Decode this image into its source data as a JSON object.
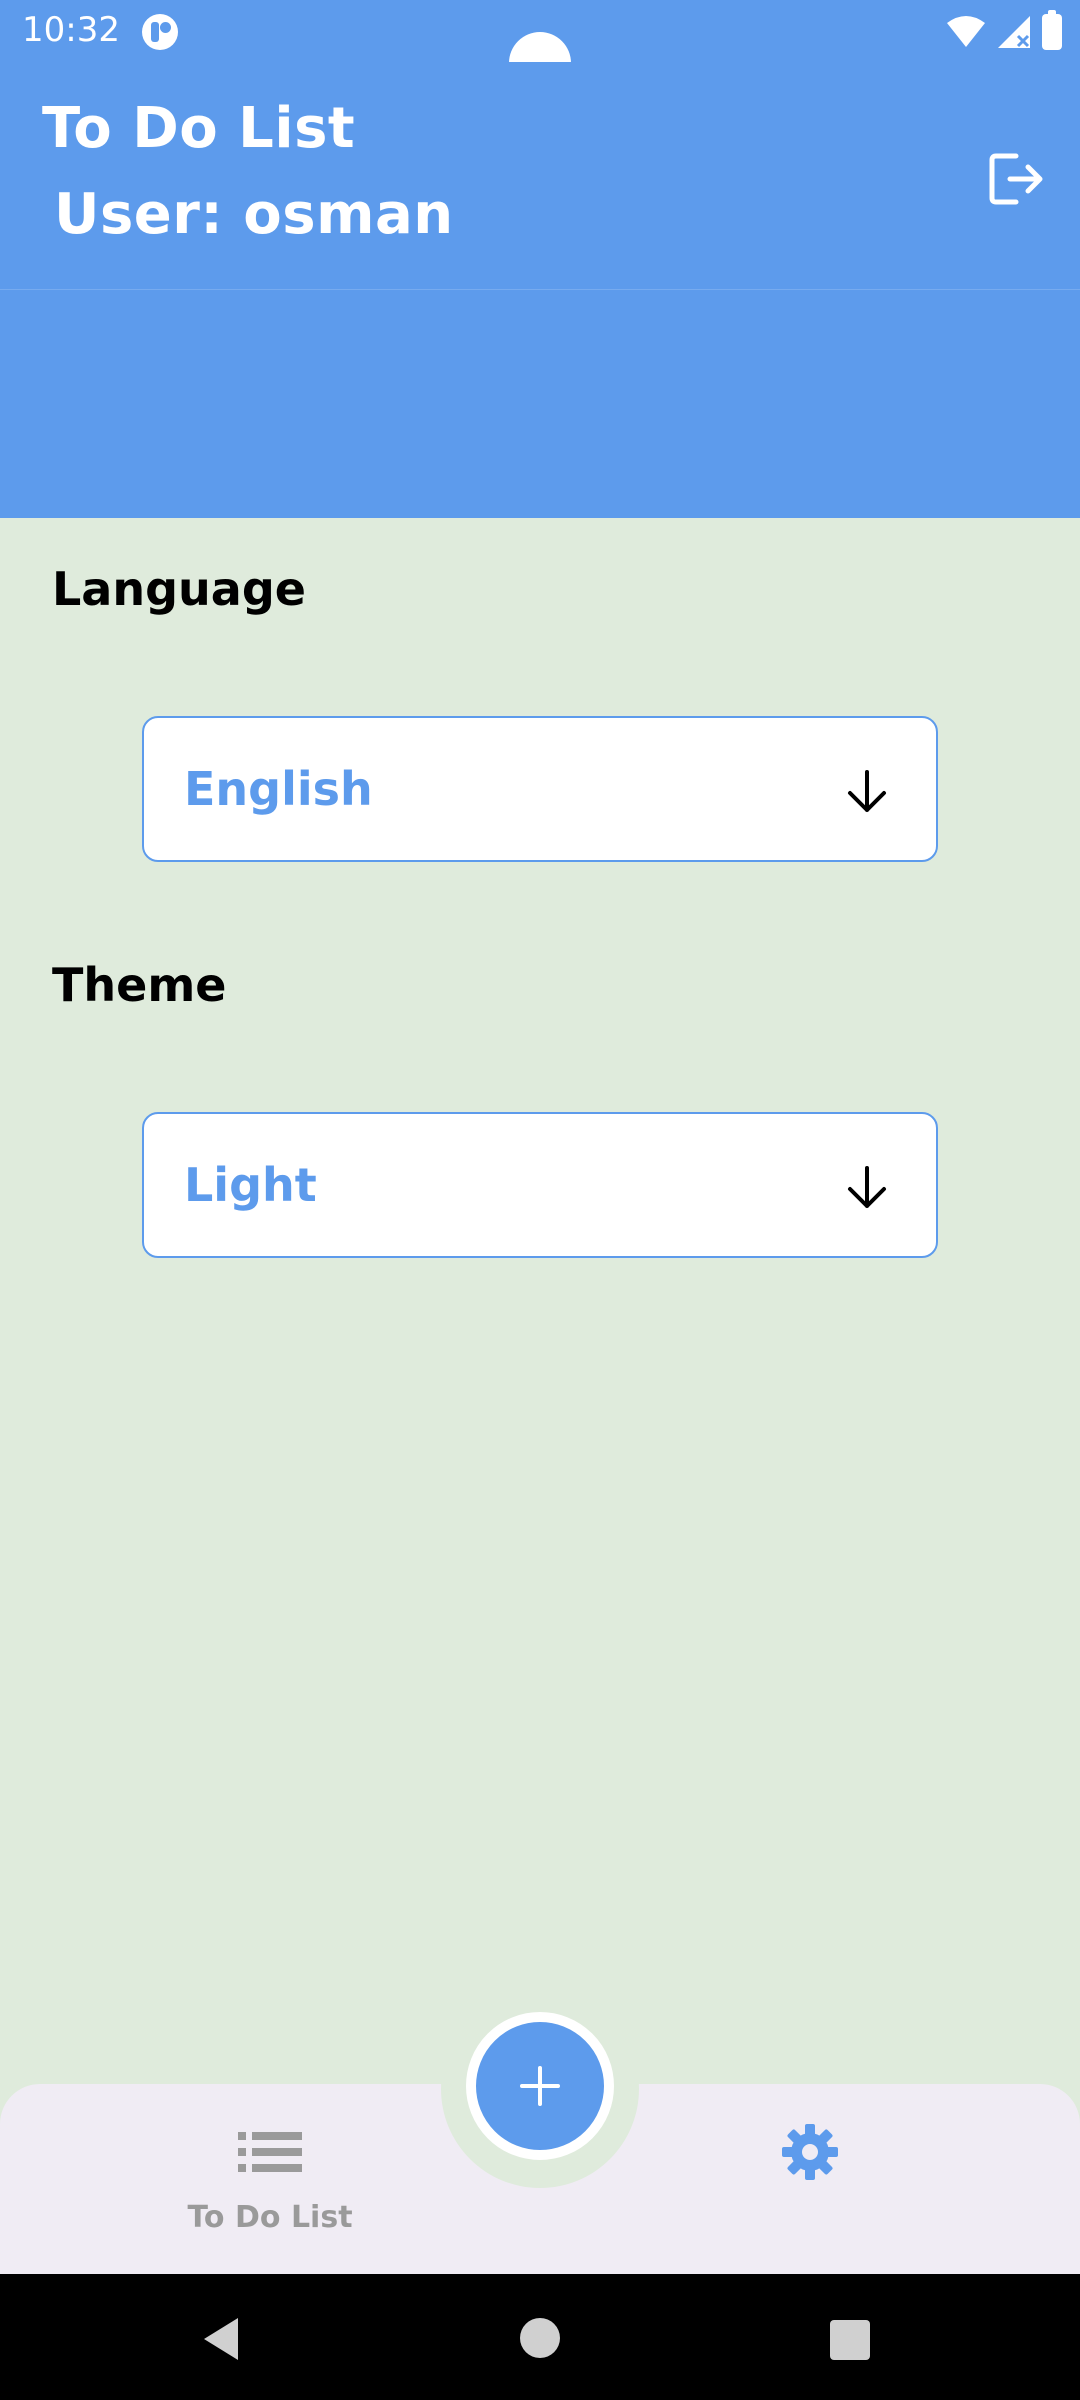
{
  "status_bar": {
    "time": "10:32",
    "icons": [
      "app-notification-icon",
      "wifi-icon",
      "signal-icon",
      "battery-icon"
    ]
  },
  "header": {
    "title": "To Do List",
    "user_label": "User: osman",
    "logout_icon": "logout-icon"
  },
  "settings": {
    "language": {
      "label": "Language",
      "selected": "English"
    },
    "theme": {
      "label": "Theme",
      "selected": "Light"
    }
  },
  "bottom_nav": {
    "todo_label": "To Do List",
    "todo_icon": "list-icon",
    "settings_icon": "gear-icon",
    "fab_icon": "plus-icon"
  },
  "colors": {
    "primary": "#5d9bec",
    "background": "#dfebdc",
    "nav_background": "#f0ecf4",
    "inactive_nav": "#9a9a9a"
  }
}
